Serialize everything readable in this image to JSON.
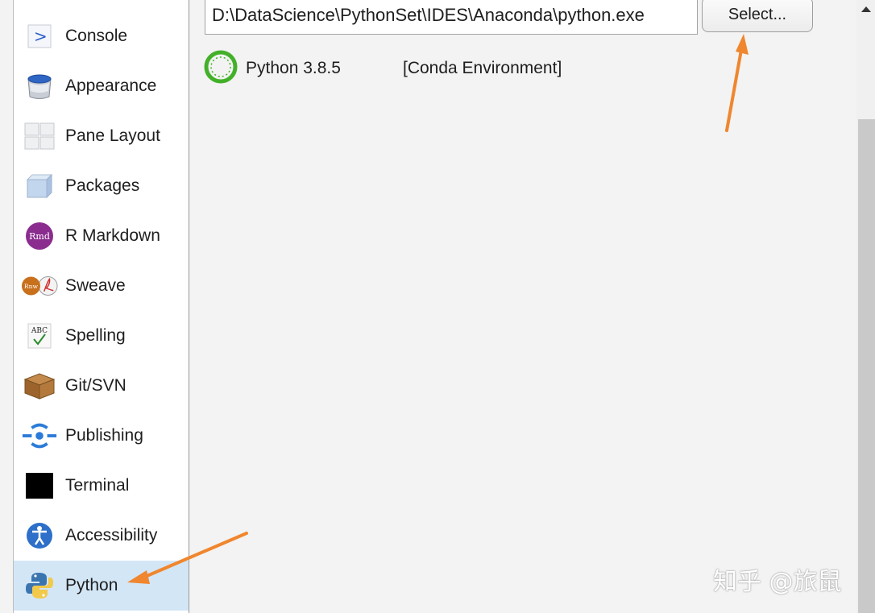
{
  "sidebar": {
    "items": [
      {
        "label": "Console",
        "icon": "console-icon"
      },
      {
        "label": "Appearance",
        "icon": "paint-bucket-icon"
      },
      {
        "label": "Pane Layout",
        "icon": "pane-layout-icon"
      },
      {
        "label": "Packages",
        "icon": "package-cube-icon"
      },
      {
        "label": "R Markdown",
        "icon": "rmd-icon"
      },
      {
        "label": "Sweave",
        "icon": "sweave-pdf-icon"
      },
      {
        "label": "Spelling",
        "icon": "abc-check-icon"
      },
      {
        "label": "Git/SVN",
        "icon": "git-box-icon"
      },
      {
        "label": "Publishing",
        "icon": "publishing-icon"
      },
      {
        "label": "Terminal",
        "icon": "terminal-icon"
      },
      {
        "label": "Accessibility",
        "icon": "accessibility-icon"
      },
      {
        "label": "Python",
        "icon": "python-icon",
        "selected": true
      }
    ],
    "icon_text": {
      "rmd": "Rmd",
      "rnw": "Rnw",
      "abc": "ABC",
      "console": ">"
    }
  },
  "python": {
    "interpreter_path": "D:\\DataScience\\PythonSet\\IDES\\Anaconda\\python.exe",
    "select_button": "Select...",
    "interpreter": {
      "name": "Python 3.8.5",
      "type": "[Conda Environment]",
      "icon": "conda-ring-icon"
    }
  },
  "watermark": "知乎 @旅鼠",
  "colors": {
    "selected_bg": "#d3e6f6",
    "arrow": "#f0862e",
    "conda_green": "#43b02a",
    "rmd_purple": "#8a2d8f"
  }
}
